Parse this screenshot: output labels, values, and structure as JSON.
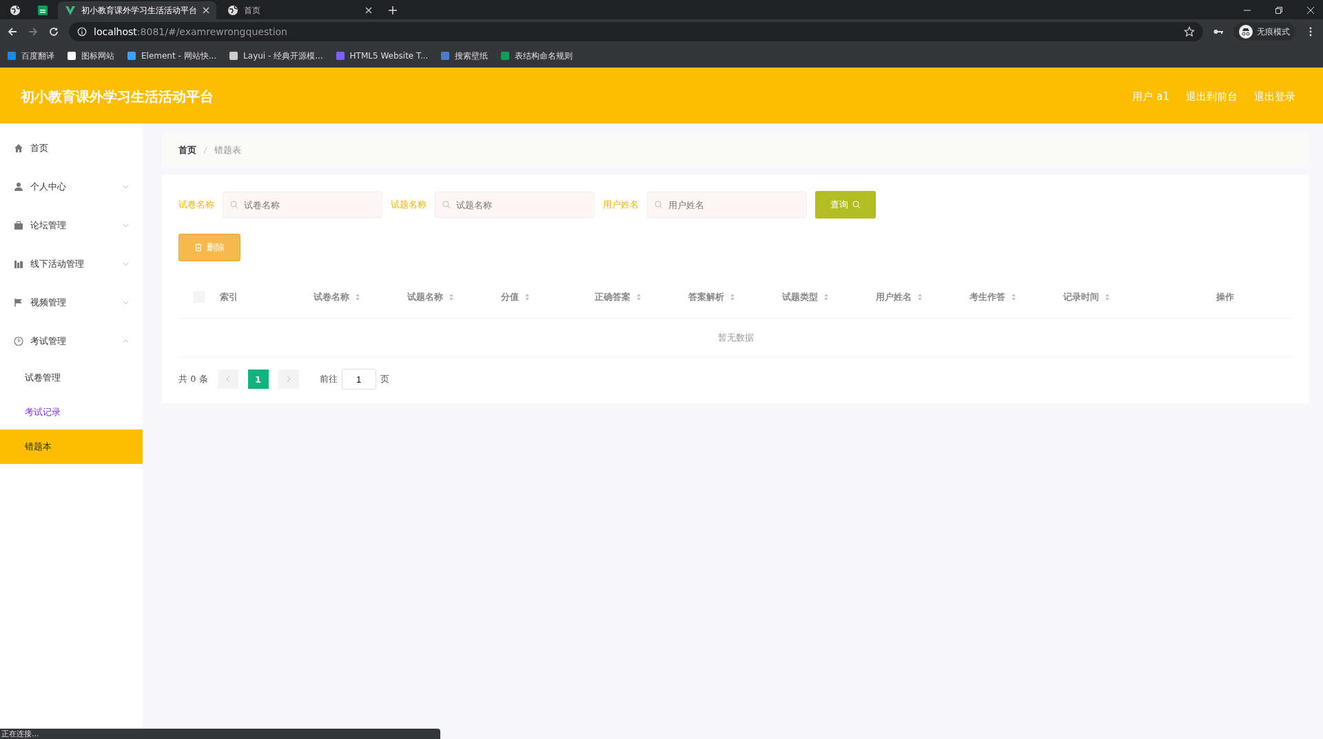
{
  "browser": {
    "tabs": [
      {
        "title": "初小教育课外学习生活活动平台",
        "selected": true
      },
      {
        "title": "首页",
        "selected": false
      }
    ],
    "url": {
      "host": "localhost",
      "path": ":8081/#/examrewrongquestion"
    },
    "profile": "无痕模式",
    "bookmarks": [
      {
        "label": "百度翻译",
        "color": "#1e88e5"
      },
      {
        "label": "图标网站",
        "color": "#ffffff"
      },
      {
        "label": "Element - 网站快...",
        "color": "#409eff"
      },
      {
        "label": "Layui - 经典开源模...",
        "color": "#cccccc"
      },
      {
        "label": "HTML5 Website T...",
        "color": "#7b61ff"
      },
      {
        "label": "搜索壁纸",
        "color": "#4a7bd1"
      },
      {
        "label": "表结构命名规则",
        "color": "#0f9d58"
      }
    ]
  },
  "header": {
    "title": "初小教育课外学习生活活动平台",
    "links": [
      "用户 a1",
      "退出到前台",
      "退出登录"
    ]
  },
  "sidebar": {
    "items": [
      {
        "label": "首页",
        "kind": "link"
      },
      {
        "label": "个人中心",
        "kind": "submenu",
        "expanded": false
      },
      {
        "label": "论坛管理",
        "kind": "submenu",
        "expanded": false
      },
      {
        "label": "线下活动管理",
        "kind": "submenu",
        "expanded": false
      },
      {
        "label": "视频管理",
        "kind": "submenu",
        "expanded": false
      },
      {
        "label": "考试管理",
        "kind": "submenu",
        "expanded": true,
        "children": [
          {
            "label": "试卷管理",
            "selected": false,
            "hovered": false
          },
          {
            "label": "考试记录",
            "selected": false,
            "hovered": true
          },
          {
            "label": "错题本",
            "selected": true,
            "hovered": false
          }
        ]
      }
    ]
  },
  "breadcrumb": [
    "首页",
    "错题表"
  ],
  "filters": [
    {
      "label": "试卷名称",
      "placeholder": "试卷名称"
    },
    {
      "label": "试题名称",
      "placeholder": "试题名称"
    },
    {
      "label": "用户姓名",
      "placeholder": "用户姓名"
    }
  ],
  "search_button": "查询",
  "delete_button": "删除",
  "table": {
    "select_all_checked": false,
    "columns": [
      "索引",
      "试卷名称",
      "试题名称",
      "分值",
      "正确答案",
      "答案解析",
      "试题类型",
      "用户姓名",
      "考生作答",
      "记录时间",
      "操作"
    ],
    "empty_text": "暂无数据"
  },
  "pagination": {
    "total": "共 0 条",
    "pages": [
      {
        "label": "1",
        "selected": true
      }
    ],
    "goto_label": "前往",
    "goto_value": "1",
    "page_suffix": "页"
  },
  "status_bar": "正在连接..."
}
